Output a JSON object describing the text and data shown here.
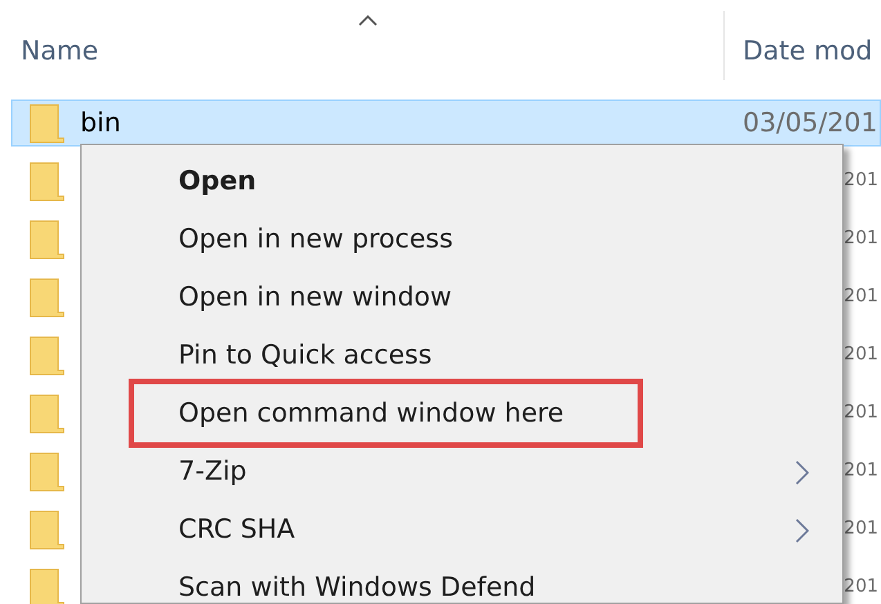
{
  "columns": [
    {
      "label": "Name",
      "sorted": true
    },
    {
      "label": "Date mod",
      "sorted": false
    }
  ],
  "rows": [
    {
      "name": "bin",
      "date": "03/05/201",
      "selected": true
    },
    {
      "date": "201",
      "selected": false
    },
    {
      "date": "201",
      "selected": false
    },
    {
      "date": "201",
      "selected": false
    },
    {
      "date": "201",
      "selected": false
    },
    {
      "date": "201",
      "selected": false
    },
    {
      "date": "201",
      "selected": false
    },
    {
      "date": "201",
      "selected": false
    },
    {
      "date": "201",
      "selected": false
    }
  ],
  "context_menu": {
    "items": [
      {
        "label": "Open",
        "default": true,
        "submenu": false,
        "highlighted": false
      },
      {
        "label": "Open in new process",
        "default": false,
        "submenu": false,
        "highlighted": false
      },
      {
        "label": "Open in new window",
        "default": false,
        "submenu": false,
        "highlighted": false
      },
      {
        "label": "Pin to Quick access",
        "default": false,
        "submenu": false,
        "highlighted": false
      },
      {
        "label": "Open command window here",
        "default": false,
        "submenu": false,
        "highlighted": true
      },
      {
        "label": "7-Zip",
        "default": false,
        "submenu": true,
        "highlighted": false
      },
      {
        "label": "CRC SHA",
        "default": false,
        "submenu": true,
        "highlighted": false
      },
      {
        "label": "Scan with Windows Defend",
        "default": false,
        "submenu": false,
        "highlighted": false
      }
    ]
  }
}
